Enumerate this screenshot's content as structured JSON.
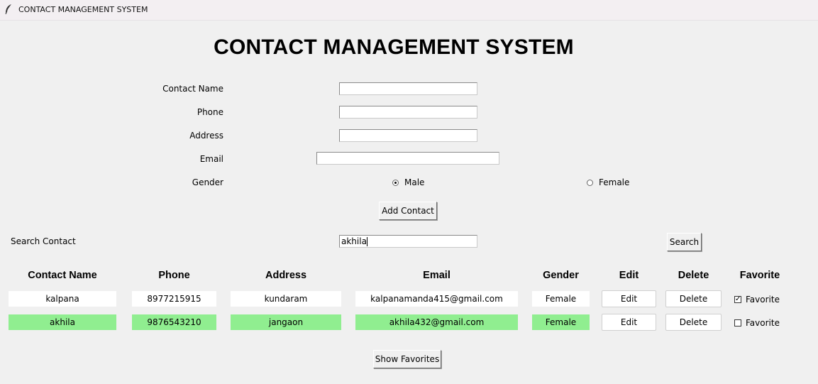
{
  "window": {
    "title": "CONTACT MANAGEMENT SYSTEM"
  },
  "heading": "CONTACT MANAGEMENT SYSTEM",
  "form": {
    "contact_name_label": "Contact Name",
    "phone_label": "Phone",
    "address_label": "Address",
    "email_label": "Email",
    "gender_label": "Gender",
    "contact_name_value": "",
    "phone_value": "",
    "address_value": "",
    "email_value": "",
    "gender_options": [
      "Male",
      "Female"
    ],
    "gender_selected": "Male",
    "add_button": "Add Contact"
  },
  "search": {
    "label": "Search Contact",
    "value": "akhila",
    "button": "Search"
  },
  "table": {
    "headers": [
      "Contact Name",
      "Phone",
      "Address",
      "Email",
      "Gender",
      "Edit",
      "Delete",
      "Favorite"
    ],
    "rows": [
      {
        "name": "kalpana",
        "phone": "8977215915",
        "address": "kundaram",
        "email": "kalpanamanda415@gmail.com",
        "gender": "Female",
        "edit": "Edit",
        "delete": "Delete",
        "favorite": "Favorite",
        "favorite_checked": true,
        "highlighted": false
      },
      {
        "name": "akhila",
        "phone": "9876543210",
        "address": "jangaon",
        "email": "akhila432@gmail.com",
        "gender": "Female",
        "edit": "Edit",
        "delete": "Delete",
        "favorite": "Favorite",
        "favorite_checked": false,
        "highlighted": true
      }
    ]
  },
  "show_favorites_button": "Show Favorites",
  "colors": {
    "highlight": "#90ee90",
    "background": "#f0f0f0"
  }
}
